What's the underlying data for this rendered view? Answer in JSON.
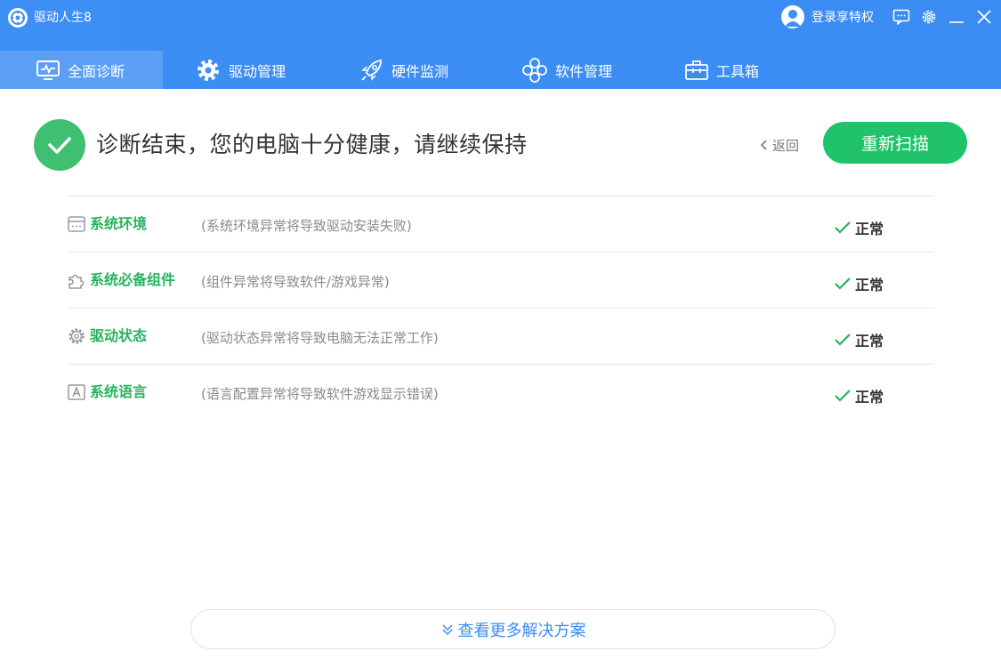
{
  "app": {
    "title": "驱动人生8"
  },
  "user": {
    "login_label": "登录享特权"
  },
  "tabs": [
    {
      "label": "全面诊断",
      "icon": "monitor-icon",
      "active": true
    },
    {
      "label": "驱动管理",
      "icon": "gear-icon",
      "active": false
    },
    {
      "label": "硬件监测",
      "icon": "rocket-icon",
      "active": false
    },
    {
      "label": "软件管理",
      "icon": "apps-icon",
      "active": false
    },
    {
      "label": "工具箱",
      "icon": "toolbox-icon",
      "active": false
    }
  ],
  "result": {
    "title": "诊断结束，您的电脑十分健康，请继续保持",
    "back_label": "返回",
    "rescan_label": "重新扫描"
  },
  "checks": [
    {
      "name": "系统环境",
      "desc": "(系统环境异常将导致驱动安装失败)",
      "status": "正常",
      "icon": "window-icon"
    },
    {
      "name": "系统必备组件",
      "desc": "(组件异常将导致软件/游戏异常)",
      "status": "正常",
      "icon": "puzzle-icon"
    },
    {
      "name": "驱动状态",
      "desc": "(驱动状态异常将导致电脑无法正常工作)",
      "status": "正常",
      "icon": "gear-icon"
    },
    {
      "name": "系统语言",
      "desc": "(语言配置异常将导致软件游戏显示错误)",
      "status": "正常",
      "icon": "language-icon"
    }
  ],
  "more": {
    "label": "查看更多解决方案"
  },
  "colors": {
    "header": "#3d8ef5",
    "success": "#21c36a",
    "link": "#3b8cf2"
  }
}
